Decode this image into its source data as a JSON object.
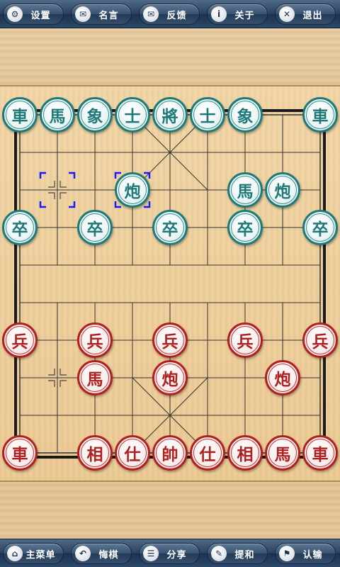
{
  "top_menu": [
    {
      "icon": "⚙",
      "icon_name": "gear-icon",
      "label": "设置"
    },
    {
      "icon": "✉",
      "icon_name": "speech-bubble-icon",
      "label": "名言"
    },
    {
      "icon": "✉",
      "icon_name": "mail-icon",
      "label": "反馈"
    },
    {
      "icon": "i",
      "icon_name": "info-icon",
      "label": "关于"
    },
    {
      "icon": "✕",
      "icon_name": "close-icon",
      "label": "退出"
    }
  ],
  "bottom_menu": [
    {
      "icon": "⌂",
      "icon_name": "home-icon",
      "label": "主菜单"
    },
    {
      "icon": "↶",
      "icon_name": "undo-icon",
      "label": "悔棋"
    },
    {
      "icon": "☰",
      "icon_name": "share-icon",
      "label": "分享"
    },
    {
      "icon": "✎",
      "icon_name": "pencil-icon",
      "label": "提和"
    },
    {
      "icon": "⚑",
      "icon_name": "flag-icon",
      "label": "认输"
    }
  ],
  "colors": {
    "black_side": "#1e7a78",
    "red_side": "#b0201e",
    "selection": "#1a1aff"
  },
  "board": {
    "files": 9,
    "ranks": 10,
    "selection_from": {
      "file": 1,
      "rank": 2
    },
    "selection_to": {
      "file": 3,
      "rank": 2
    },
    "crosshair_marks": [
      {
        "file": 1,
        "rank": 2
      },
      {
        "file": 1,
        "rank": 7
      }
    ]
  },
  "pieces": [
    {
      "side": "black",
      "char": "車",
      "file": 0,
      "rank": 0
    },
    {
      "side": "black",
      "char": "馬",
      "file": 1,
      "rank": 0
    },
    {
      "side": "black",
      "char": "象",
      "file": 2,
      "rank": 0
    },
    {
      "side": "black",
      "char": "士",
      "file": 3,
      "rank": 0
    },
    {
      "side": "black",
      "char": "將",
      "file": 4,
      "rank": 0
    },
    {
      "side": "black",
      "char": "士",
      "file": 5,
      "rank": 0
    },
    {
      "side": "black",
      "char": "象",
      "file": 6,
      "rank": 0
    },
    {
      "side": "black",
      "char": "車",
      "file": 8,
      "rank": 0
    },
    {
      "side": "black",
      "char": "炮",
      "file": 3,
      "rank": 2
    },
    {
      "side": "black",
      "char": "馬",
      "file": 6,
      "rank": 2
    },
    {
      "side": "black",
      "char": "炮",
      "file": 7,
      "rank": 2
    },
    {
      "side": "black",
      "char": "卒",
      "file": 0,
      "rank": 3
    },
    {
      "side": "black",
      "char": "卒",
      "file": 2,
      "rank": 3
    },
    {
      "side": "black",
      "char": "卒",
      "file": 4,
      "rank": 3
    },
    {
      "side": "black",
      "char": "卒",
      "file": 6,
      "rank": 3
    },
    {
      "side": "black",
      "char": "卒",
      "file": 8,
      "rank": 3
    },
    {
      "side": "red",
      "char": "兵",
      "file": 0,
      "rank": 6
    },
    {
      "side": "red",
      "char": "兵",
      "file": 2,
      "rank": 6
    },
    {
      "side": "red",
      "char": "兵",
      "file": 4,
      "rank": 6
    },
    {
      "side": "red",
      "char": "兵",
      "file": 6,
      "rank": 6
    },
    {
      "side": "red",
      "char": "兵",
      "file": 8,
      "rank": 6
    },
    {
      "side": "red",
      "char": "馬",
      "file": 2,
      "rank": 7
    },
    {
      "side": "red",
      "char": "炮",
      "file": 4,
      "rank": 7
    },
    {
      "side": "red",
      "char": "炮",
      "file": 7,
      "rank": 7
    },
    {
      "side": "red",
      "char": "車",
      "file": 0,
      "rank": 9
    },
    {
      "side": "red",
      "char": "相",
      "file": 2,
      "rank": 9
    },
    {
      "side": "red",
      "char": "仕",
      "file": 3,
      "rank": 9
    },
    {
      "side": "red",
      "char": "帥",
      "file": 4,
      "rank": 9
    },
    {
      "side": "red",
      "char": "仕",
      "file": 5,
      "rank": 9
    },
    {
      "side": "red",
      "char": "相",
      "file": 6,
      "rank": 9
    },
    {
      "side": "red",
      "char": "馬",
      "file": 7,
      "rank": 9
    },
    {
      "side": "red",
      "char": "車",
      "file": 8,
      "rank": 9
    }
  ]
}
